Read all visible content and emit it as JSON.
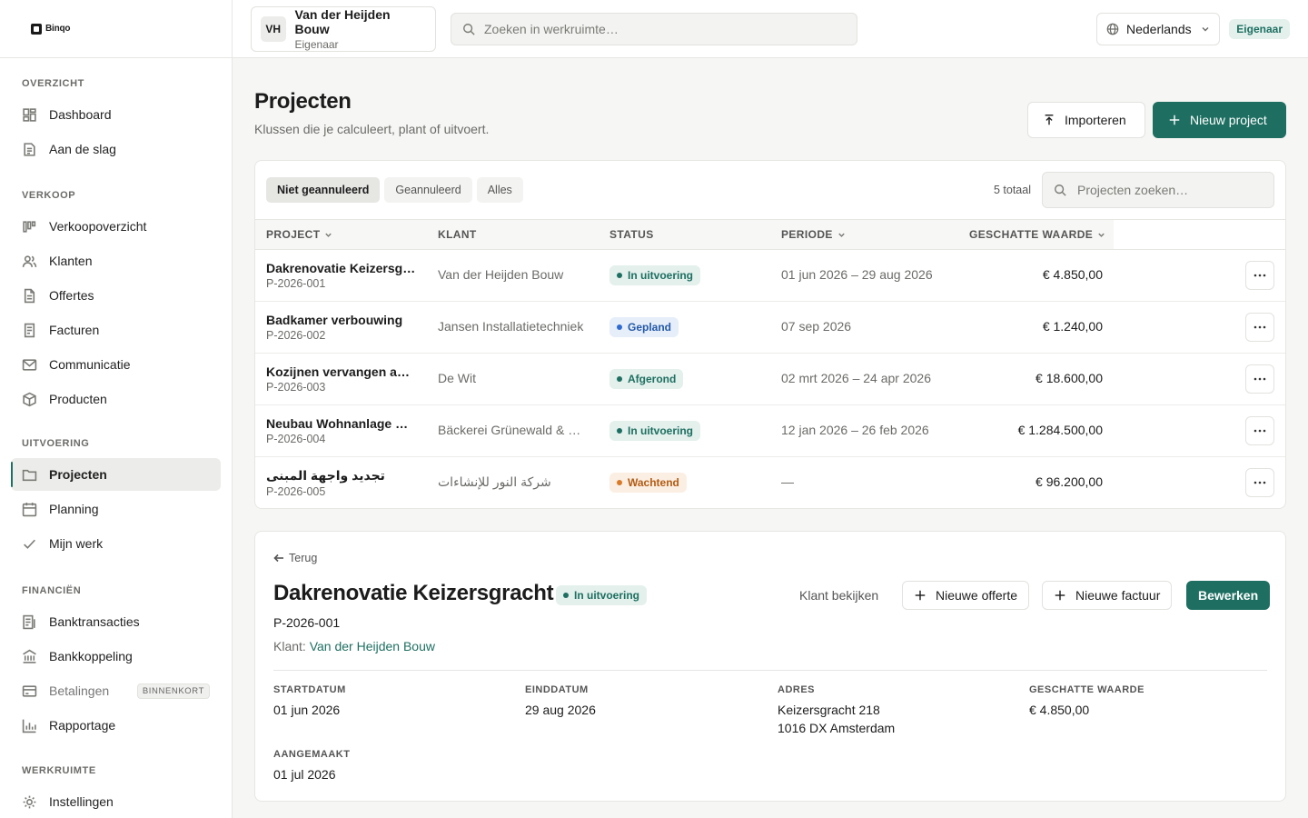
{
  "brand": {
    "name": "Binqo"
  },
  "sidebar": {
    "sections": [
      {
        "heading": "OVERZICHT",
        "items": [
          {
            "label": "Dashboard",
            "icon": "dashboard-icon"
          },
          {
            "label": "Aan de slag",
            "icon": "checklist-icon"
          }
        ]
      },
      {
        "heading": "VERKOOP",
        "items": [
          {
            "label": "Verkoopoverzicht",
            "icon": "pipeline-icon"
          },
          {
            "label": "Klanten",
            "icon": "users-icon"
          },
          {
            "label": "Offertes",
            "icon": "document-icon"
          },
          {
            "label": "Facturen",
            "icon": "receipt-icon"
          },
          {
            "label": "Communicatie",
            "icon": "mail-icon"
          },
          {
            "label": "Producten",
            "icon": "box-icon"
          }
        ]
      },
      {
        "heading": "UITVOERING",
        "items": [
          {
            "label": "Projecten",
            "icon": "folder-icon",
            "active": true
          },
          {
            "label": "Planning",
            "icon": "calendar-icon"
          },
          {
            "label": "Mijn werk",
            "icon": "check-icon"
          }
        ]
      },
      {
        "heading": "FINANCIËN",
        "items": [
          {
            "label": "Banktransacties",
            "icon": "transactions-icon"
          },
          {
            "label": "Bankkoppeling",
            "icon": "bank-icon"
          },
          {
            "label": "Betalingen",
            "icon": "card-icon",
            "badge": "BINNENKORT"
          },
          {
            "label": "Rapportage",
            "icon": "chart-icon"
          }
        ]
      },
      {
        "heading": "WERKRUIMTE",
        "items": [
          {
            "label": "Instellingen",
            "icon": "gear-icon"
          }
        ]
      }
    ]
  },
  "topbar": {
    "workspace": {
      "initials": "VH",
      "name": "Van der Heijden Bouw",
      "role": "Eigenaar"
    },
    "search_placeholder": "Zoeken in werkruimte…",
    "language": "Nederlands",
    "role_badge": "Eigenaar"
  },
  "page": {
    "title": "Projecten",
    "subtitle": "Klussen die je calculeert, plant of uitvoert.",
    "import_label": "Importeren",
    "new_label": "Nieuw project"
  },
  "list": {
    "tabs": [
      "Niet geannuleerd",
      "Geannuleerd",
      "Alles"
    ],
    "active_tab": 0,
    "total": "5 totaal",
    "search_placeholder": "Projecten zoeken…",
    "columns": {
      "project": "PROJECT",
      "client": "KLANT",
      "status": "STATUS",
      "period": "PERIODE",
      "value": "GESCHATTE WAARDE"
    },
    "rows": [
      {
        "name": "Dakrenovatie Keizersgracht",
        "code": "P-2026-001",
        "client": "Van der Heijden Bouw",
        "status": "In uitvoering",
        "status_color": "green",
        "period": "01 jun 2026 – 29 aug 2026",
        "value": "€ 4.850,00"
      },
      {
        "name": "Badkamer verbouwing",
        "code": "P-2026-002",
        "client": "Jansen Installatietechniek",
        "status": "Gepland",
        "status_color": "blue",
        "period": "07 sep 2026",
        "value": "€ 1.240,00"
      },
      {
        "name": "Kozijnen vervangen achtergevel",
        "code": "P-2026-003",
        "client": "De Wit",
        "status": "Afgerond",
        "status_color": "green",
        "period": "02 mrt 2026 – 24 apr 2026",
        "value": "€ 18.600,00"
      },
      {
        "name": "Neubau Wohnanlage Charlottenburg",
        "code": "P-2026-004",
        "client": "Bäckerei Grünewald & Söhne",
        "status": "In uitvoering",
        "status_color": "green",
        "period": "12 jan 2026 – 26 feb 2026",
        "value": "€ 1.284.500,00"
      },
      {
        "name": "تجديد واجهة المبنى",
        "code": "P-2026-005",
        "client": "شركة النور للإنشاءات",
        "status": "Wachtend",
        "status_color": "orange",
        "period": "—",
        "value": "€ 96.200,00"
      }
    ]
  },
  "detail": {
    "back": "Terug",
    "title": "Dakrenovatie Keizersgracht",
    "status": "In uitvoering",
    "code": "P-2026-001",
    "client_label": "Klant:",
    "client": "Van der Heijden Bouw",
    "view_client": "Klant bekijken",
    "new_quote": "Nieuwe offerte",
    "new_invoice": "Nieuwe factuur",
    "edit": "Bewerken",
    "fields": {
      "start_label": "STARTDATUM",
      "start": "01 jun 2026",
      "end_label": "EINDDATUM",
      "end": "29 aug 2026",
      "address_label": "ADRES",
      "address_1": "Keizersgracht 218",
      "address_2": "1016 DX Amsterdam",
      "value_label": "GESCHATTE WAARDE",
      "value": "€ 4.850,00",
      "created_label": "AANGEMAAKT",
      "created": "01 jul 2026"
    }
  },
  "colors": {
    "accent": "#1e6f61",
    "accent_soft": "#e3f0ec",
    "blue": "#2f6bd0",
    "orange": "#d97a27"
  }
}
